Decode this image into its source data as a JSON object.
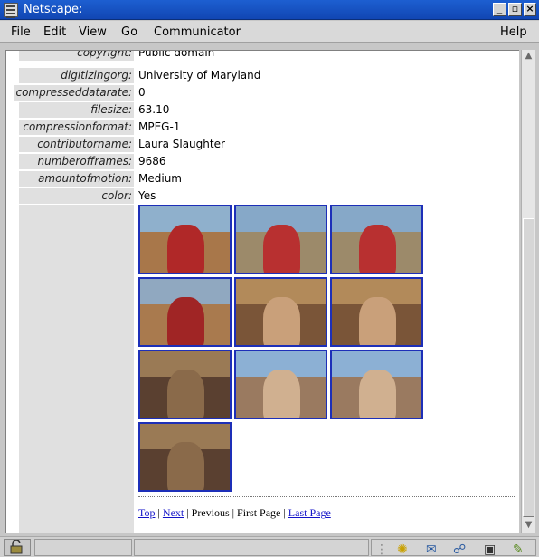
{
  "window": {
    "title": "Netscape:"
  },
  "menus": [
    "File",
    "Edit",
    "View",
    "Go",
    "Communicator",
    "Help"
  ],
  "metadata": [
    {
      "key": "copyright:",
      "value": "Public domain"
    },
    {
      "key": "digitizingorg:",
      "value": "University of Maryland"
    },
    {
      "key": "compresseddatarate:",
      "value": "0"
    },
    {
      "key": "filesize:",
      "value": "63.10"
    },
    {
      "key": "compressionformat:",
      "value": "MPEG-1"
    },
    {
      "key": "contributorname:",
      "value": "Laura Slaughter"
    },
    {
      "key": "numberofframes:",
      "value": "9686"
    },
    {
      "key": "amountofmotion:",
      "value": "Medium"
    },
    {
      "key": "color:",
      "value": "Yes"
    }
  ],
  "keyframes": [
    {
      "scene": "rock-wall-group"
    },
    {
      "scene": "three-people-outdoors"
    },
    {
      "scene": "three-people-outdoors"
    },
    {
      "scene": "rock-wall-couple"
    },
    {
      "scene": "man-closeup-glasses"
    },
    {
      "scene": "man-closeup-glasses"
    },
    {
      "scene": "woman-closeup-curly-hair"
    },
    {
      "scene": "man-closeup-sky"
    },
    {
      "scene": "man-closeup-sky"
    },
    {
      "scene": "woman-closeup-curly-hair"
    }
  ],
  "nav": {
    "top": "Top",
    "next": "Next",
    "previous": "Previous",
    "first_page": "First Page",
    "last_page": "Last Page",
    "sep": "|"
  },
  "colors": {
    "titlebar": "#1d5fd1",
    "thumb_border": "#1d2fb8",
    "link": "#1212c8"
  },
  "status_icons": [
    "security-lock-icon",
    "component-bar-icon",
    "navigator-icon",
    "mail-icon",
    "discussion-icon",
    "composer-icon",
    "edit-icon"
  ]
}
